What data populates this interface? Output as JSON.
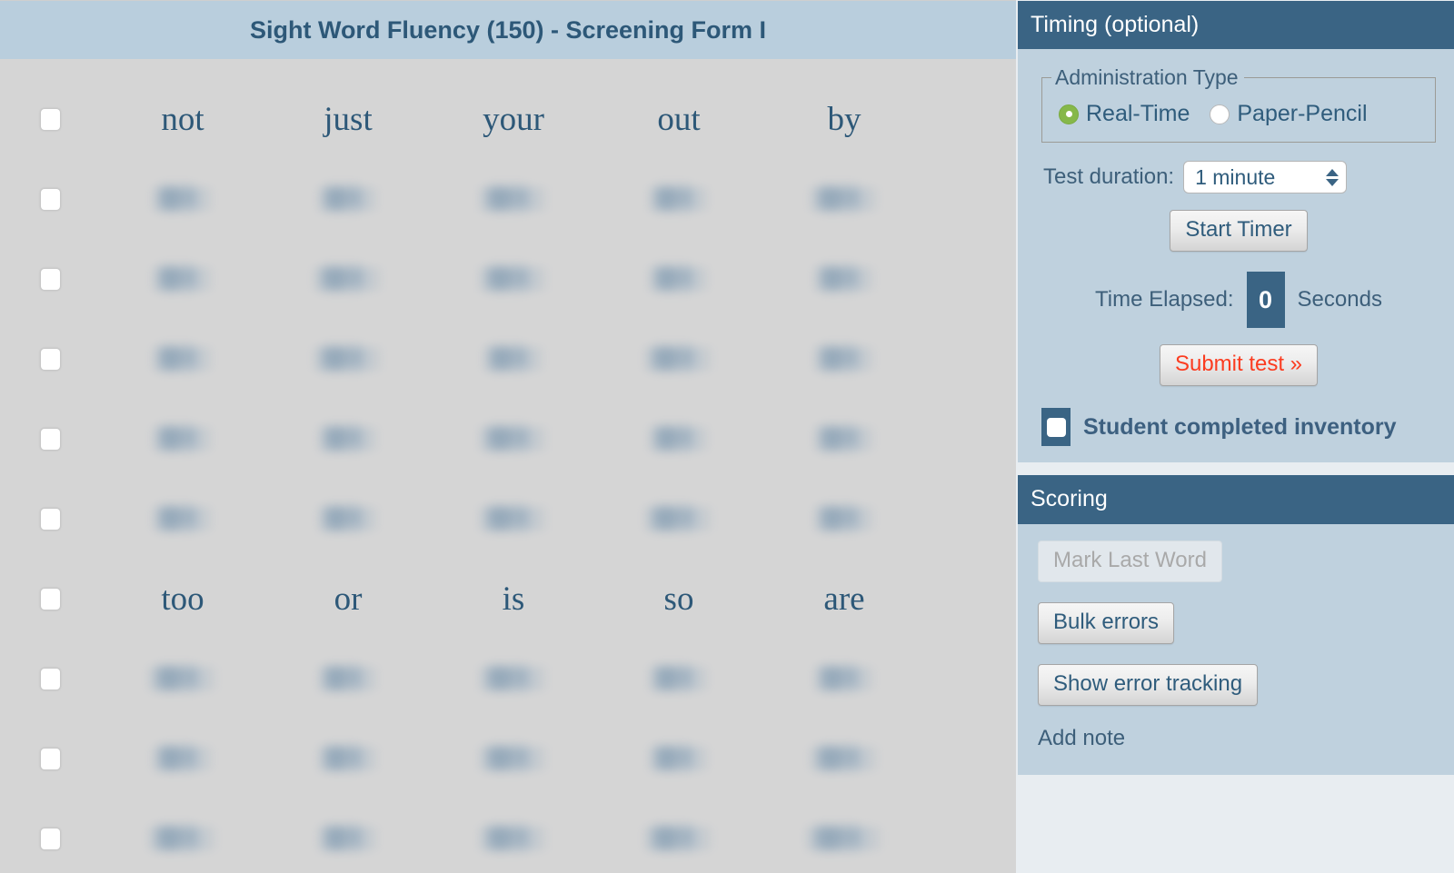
{
  "main": {
    "title": "Sight Word Fluency (150) - Screening Form I",
    "rows": [
      {
        "blurred": false,
        "words": [
          "not",
          "just",
          "your",
          "out",
          "by"
        ]
      },
      {
        "blurred": true,
        "words": [
          "word",
          "word",
          "words",
          "word",
          "words"
        ]
      },
      {
        "blurred": true,
        "words": [
          "word",
          "words",
          "words",
          "word",
          "word"
        ]
      },
      {
        "blurred": true,
        "words": [
          "word",
          "words",
          "word",
          "words",
          "word"
        ]
      },
      {
        "blurred": true,
        "words": [
          "word",
          "word",
          "words",
          "word",
          "word"
        ]
      },
      {
        "blurred": true,
        "words": [
          "word",
          "word",
          "words",
          "words",
          "word"
        ]
      },
      {
        "blurred": false,
        "words": [
          "too",
          "or",
          "is",
          "so",
          "are"
        ]
      },
      {
        "blurred": true,
        "words": [
          "words",
          "word",
          "words",
          "word",
          "word"
        ]
      },
      {
        "blurred": true,
        "words": [
          "word",
          "word",
          "words",
          "word",
          "words"
        ]
      },
      {
        "blurred": true,
        "words": [
          "words",
          "word",
          "words",
          "words",
          "wordsy"
        ]
      }
    ]
  },
  "timing": {
    "header": "Timing (optional)",
    "admin_type": {
      "legend": "Administration Type",
      "options": [
        {
          "label": "Real-Time",
          "selected": true
        },
        {
          "label": "Paper-Pencil",
          "selected": false
        }
      ]
    },
    "duration_label": "Test duration:",
    "duration_value": "1 minute",
    "start_timer_label": "Start Timer",
    "elapsed_label": "Time Elapsed:",
    "elapsed_value": "0",
    "elapsed_unit": "Seconds",
    "submit_label": "Submit test »",
    "completed_label": "Student completed inventory"
  },
  "scoring": {
    "header": "Scoring",
    "mark_last_word_label": "Mark Last Word",
    "bulk_errors_label": "Bulk errors",
    "show_error_tracking_label": "Show error tracking",
    "add_note_label": "Add note"
  },
  "colors": {
    "panel_header": "#3a6484",
    "panel_body": "#bfd1de",
    "title_bar": "#b9cedd",
    "main_bg": "#d5d5d5",
    "accent_text": "#2d5878",
    "radio_on": "#86b84a",
    "danger": "#fb3c20"
  }
}
